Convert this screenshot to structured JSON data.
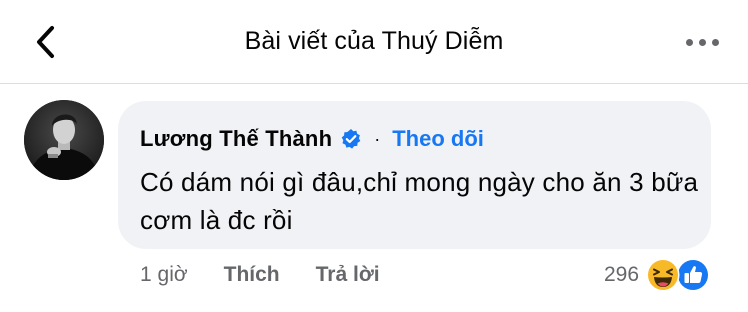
{
  "header": {
    "title": "Bài viết của Thuý Diễm",
    "back_icon": "chevron-left-icon",
    "more_icon": "more-horizontal-icon"
  },
  "comment": {
    "author": "Lương Thế Thành",
    "verified_icon": "verified-badge-icon",
    "separator": "·",
    "follow_label": "Theo dõi",
    "text": "Có dám nói gì đâu,chỉ mong ngày cho ăn 3 bữa cơm là đc rồi",
    "time": "1 giờ",
    "like_label": "Thích",
    "reply_label": "Trả lời",
    "reaction_count": "296",
    "reactions": [
      "haha-reaction-icon",
      "like-reaction-icon"
    ]
  },
  "colors": {
    "accent": "#1877f2",
    "bubble": "#f0f2f5",
    "secondary_text": "#65676b",
    "primary_text": "#050505"
  }
}
